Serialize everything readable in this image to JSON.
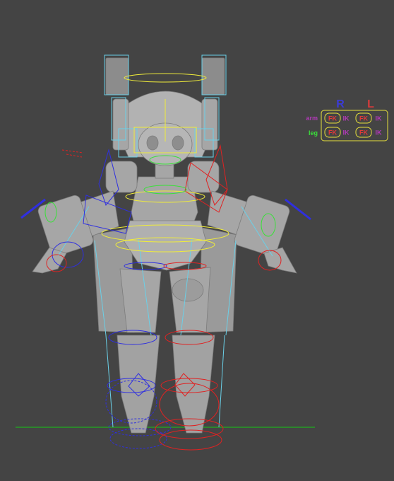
{
  "panel": {
    "header_r": "R",
    "header_l": "L",
    "rows": [
      {
        "label": "arm",
        "r_fk": "FK",
        "r_ik": "IK",
        "l_fk": "FK",
        "l_ik": "IK"
      },
      {
        "label": "leg",
        "r_fk": "FK",
        "r_ik": "IK",
        "l_fk": "FK",
        "l_ik": "IK"
      }
    ]
  },
  "colors": {
    "background": "#444444",
    "mesh": "#a9a9a9",
    "ground": "#1fae1f",
    "right_ctrl": "#2f2fe0",
    "left_ctrl": "#e02222",
    "center_ctrl": "#f0ec3a",
    "bone": "#6ad0e8",
    "panel_border": "#e6df3c",
    "fk": "#e23a3a",
    "ik": "#b03ab6",
    "arm_label": "#b03ab6",
    "leg_label": "#3ae03a",
    "header_r": "#3b3bd6",
    "header_l": "#d63b3b"
  }
}
